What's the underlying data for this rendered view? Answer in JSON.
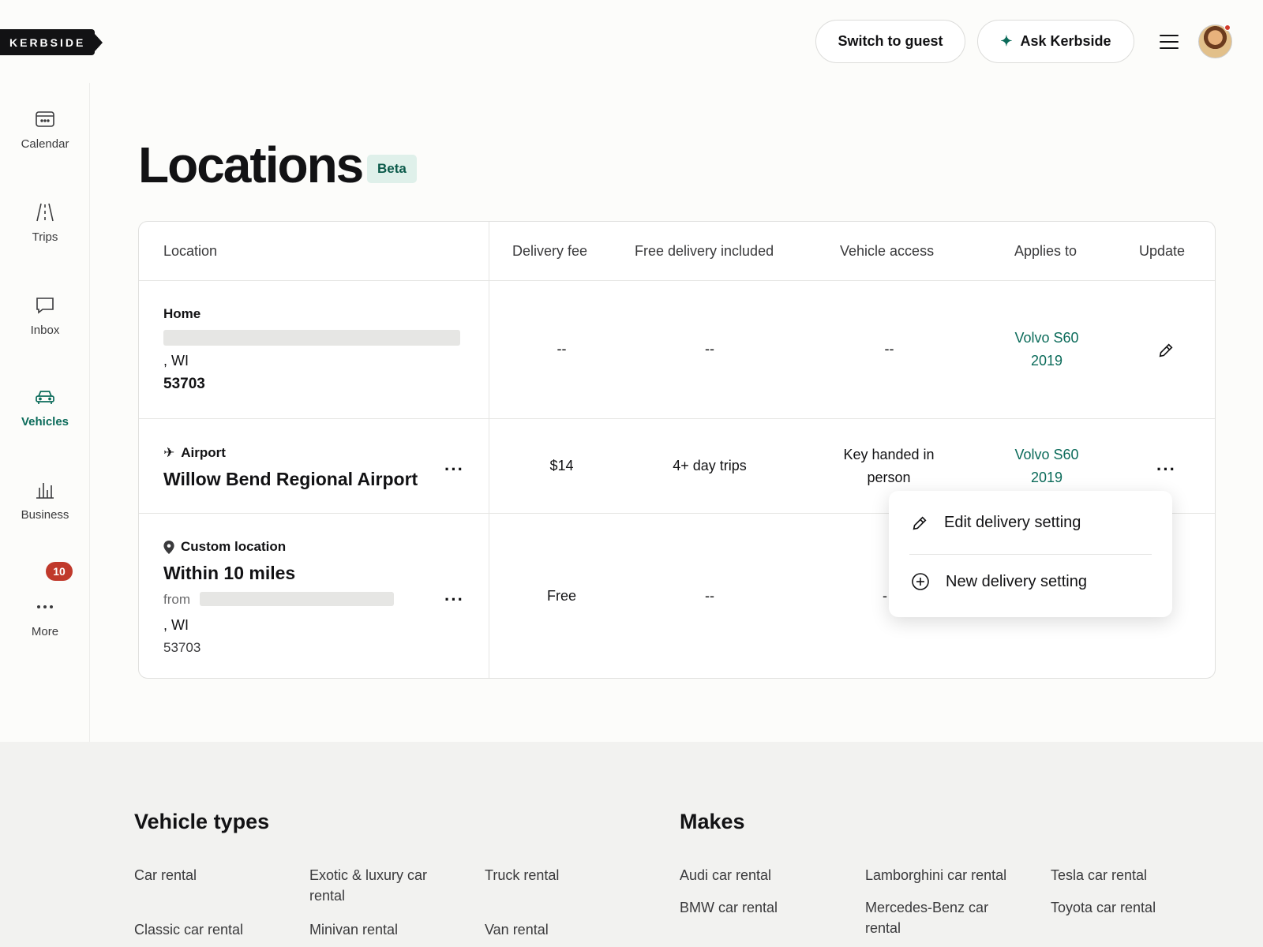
{
  "brand": {
    "logo_text": "KERBSIDE"
  },
  "header": {
    "switch_label": "Switch to guest",
    "ask_label": "Ask Kerbside"
  },
  "sidebar": {
    "items": [
      {
        "label": "Calendar",
        "icon": "calendar-icon"
      },
      {
        "label": "Trips",
        "icon": "road-icon"
      },
      {
        "label": "Inbox",
        "icon": "chat-icon"
      },
      {
        "label": "Vehicles",
        "icon": "car-icon",
        "active": true
      },
      {
        "label": "Business",
        "icon": "bar-chart-icon"
      },
      {
        "label": "More",
        "icon": "more-dots-icon"
      }
    ],
    "more_badge": "10"
  },
  "page": {
    "title": "Locations",
    "badge": "Beta"
  },
  "table": {
    "headers": {
      "location": "Location",
      "fee": "Delivery fee",
      "free": "Free delivery included",
      "access": "Vehicle access",
      "applies": "Applies to",
      "update": "Update"
    },
    "rows": [
      {
        "type": "Home",
        "state": ", WI",
        "zip": "53703",
        "fee": "--",
        "free": "--",
        "access": "--",
        "applies_line1": "Volvo S60",
        "applies_line2": "2019"
      },
      {
        "type": "Airport",
        "name": "Willow Bend Regional Airport",
        "fee": "$14",
        "free": "4+ day trips",
        "access_line1": "Key handed in",
        "access_line2": "person",
        "applies_line1": "Volvo S60",
        "applies_line2": "2019"
      },
      {
        "type": "Custom location",
        "name": "Within 10 miles",
        "from": "from",
        "state": ", WI",
        "zip": "53703",
        "fee": "Free",
        "free": "--",
        "access": "-"
      }
    ]
  },
  "dropdown": {
    "items": [
      {
        "label": "Edit delivery setting",
        "icon": "pencil-icon"
      },
      {
        "label": "New delivery setting",
        "icon": "plus-circle-icon"
      }
    ]
  },
  "footer": {
    "vehicle_types": {
      "title": "Vehicle types",
      "links": [
        "Car rental",
        "Exotic & luxury car rental",
        "Truck rental",
        "Classic car rental",
        "Minivan rental",
        "Van rental"
      ]
    },
    "makes": {
      "title": "Makes",
      "links": [
        "Audi car rental",
        "Lamborghini car rental",
        "Tesla car rental",
        "BMW car rental",
        "Mercedes-Benz car rental",
        "Toyota car rental"
      ]
    }
  }
}
